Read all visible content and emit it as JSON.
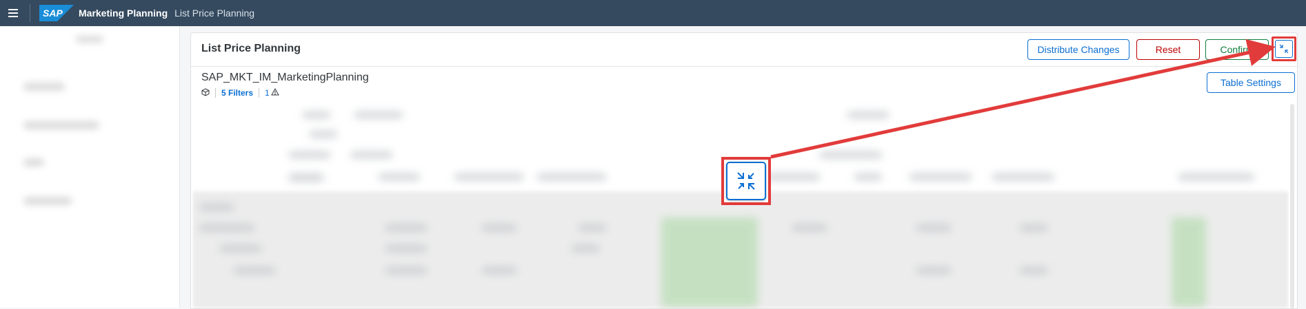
{
  "shell": {
    "logo_text": "SAP",
    "app_title": "Marketing Planning",
    "app_subtitle": "List Price Planning",
    "menu_icon": "hamburger-menu-icon"
  },
  "card": {
    "title": "List Price Planning",
    "buttons": {
      "distribute": "Distribute Changes",
      "reset": "Reset",
      "confirm": "Confirm",
      "exit_fullscreen_icon": "exit-fullscreen-icon"
    },
    "model_name": "SAP_MKT_IM_MarketingPlanning",
    "filters_label": "5 Filters",
    "warning_count": "1",
    "table_settings": "Table Settings"
  },
  "callout": {
    "icon": "exit-fullscreen-icon",
    "annotation_color": "#e23b3b"
  },
  "colors": {
    "shell_bg": "#354a5f",
    "accent": "#0a6ed1",
    "reject": "#bb0000",
    "accept": "#107e3e"
  }
}
